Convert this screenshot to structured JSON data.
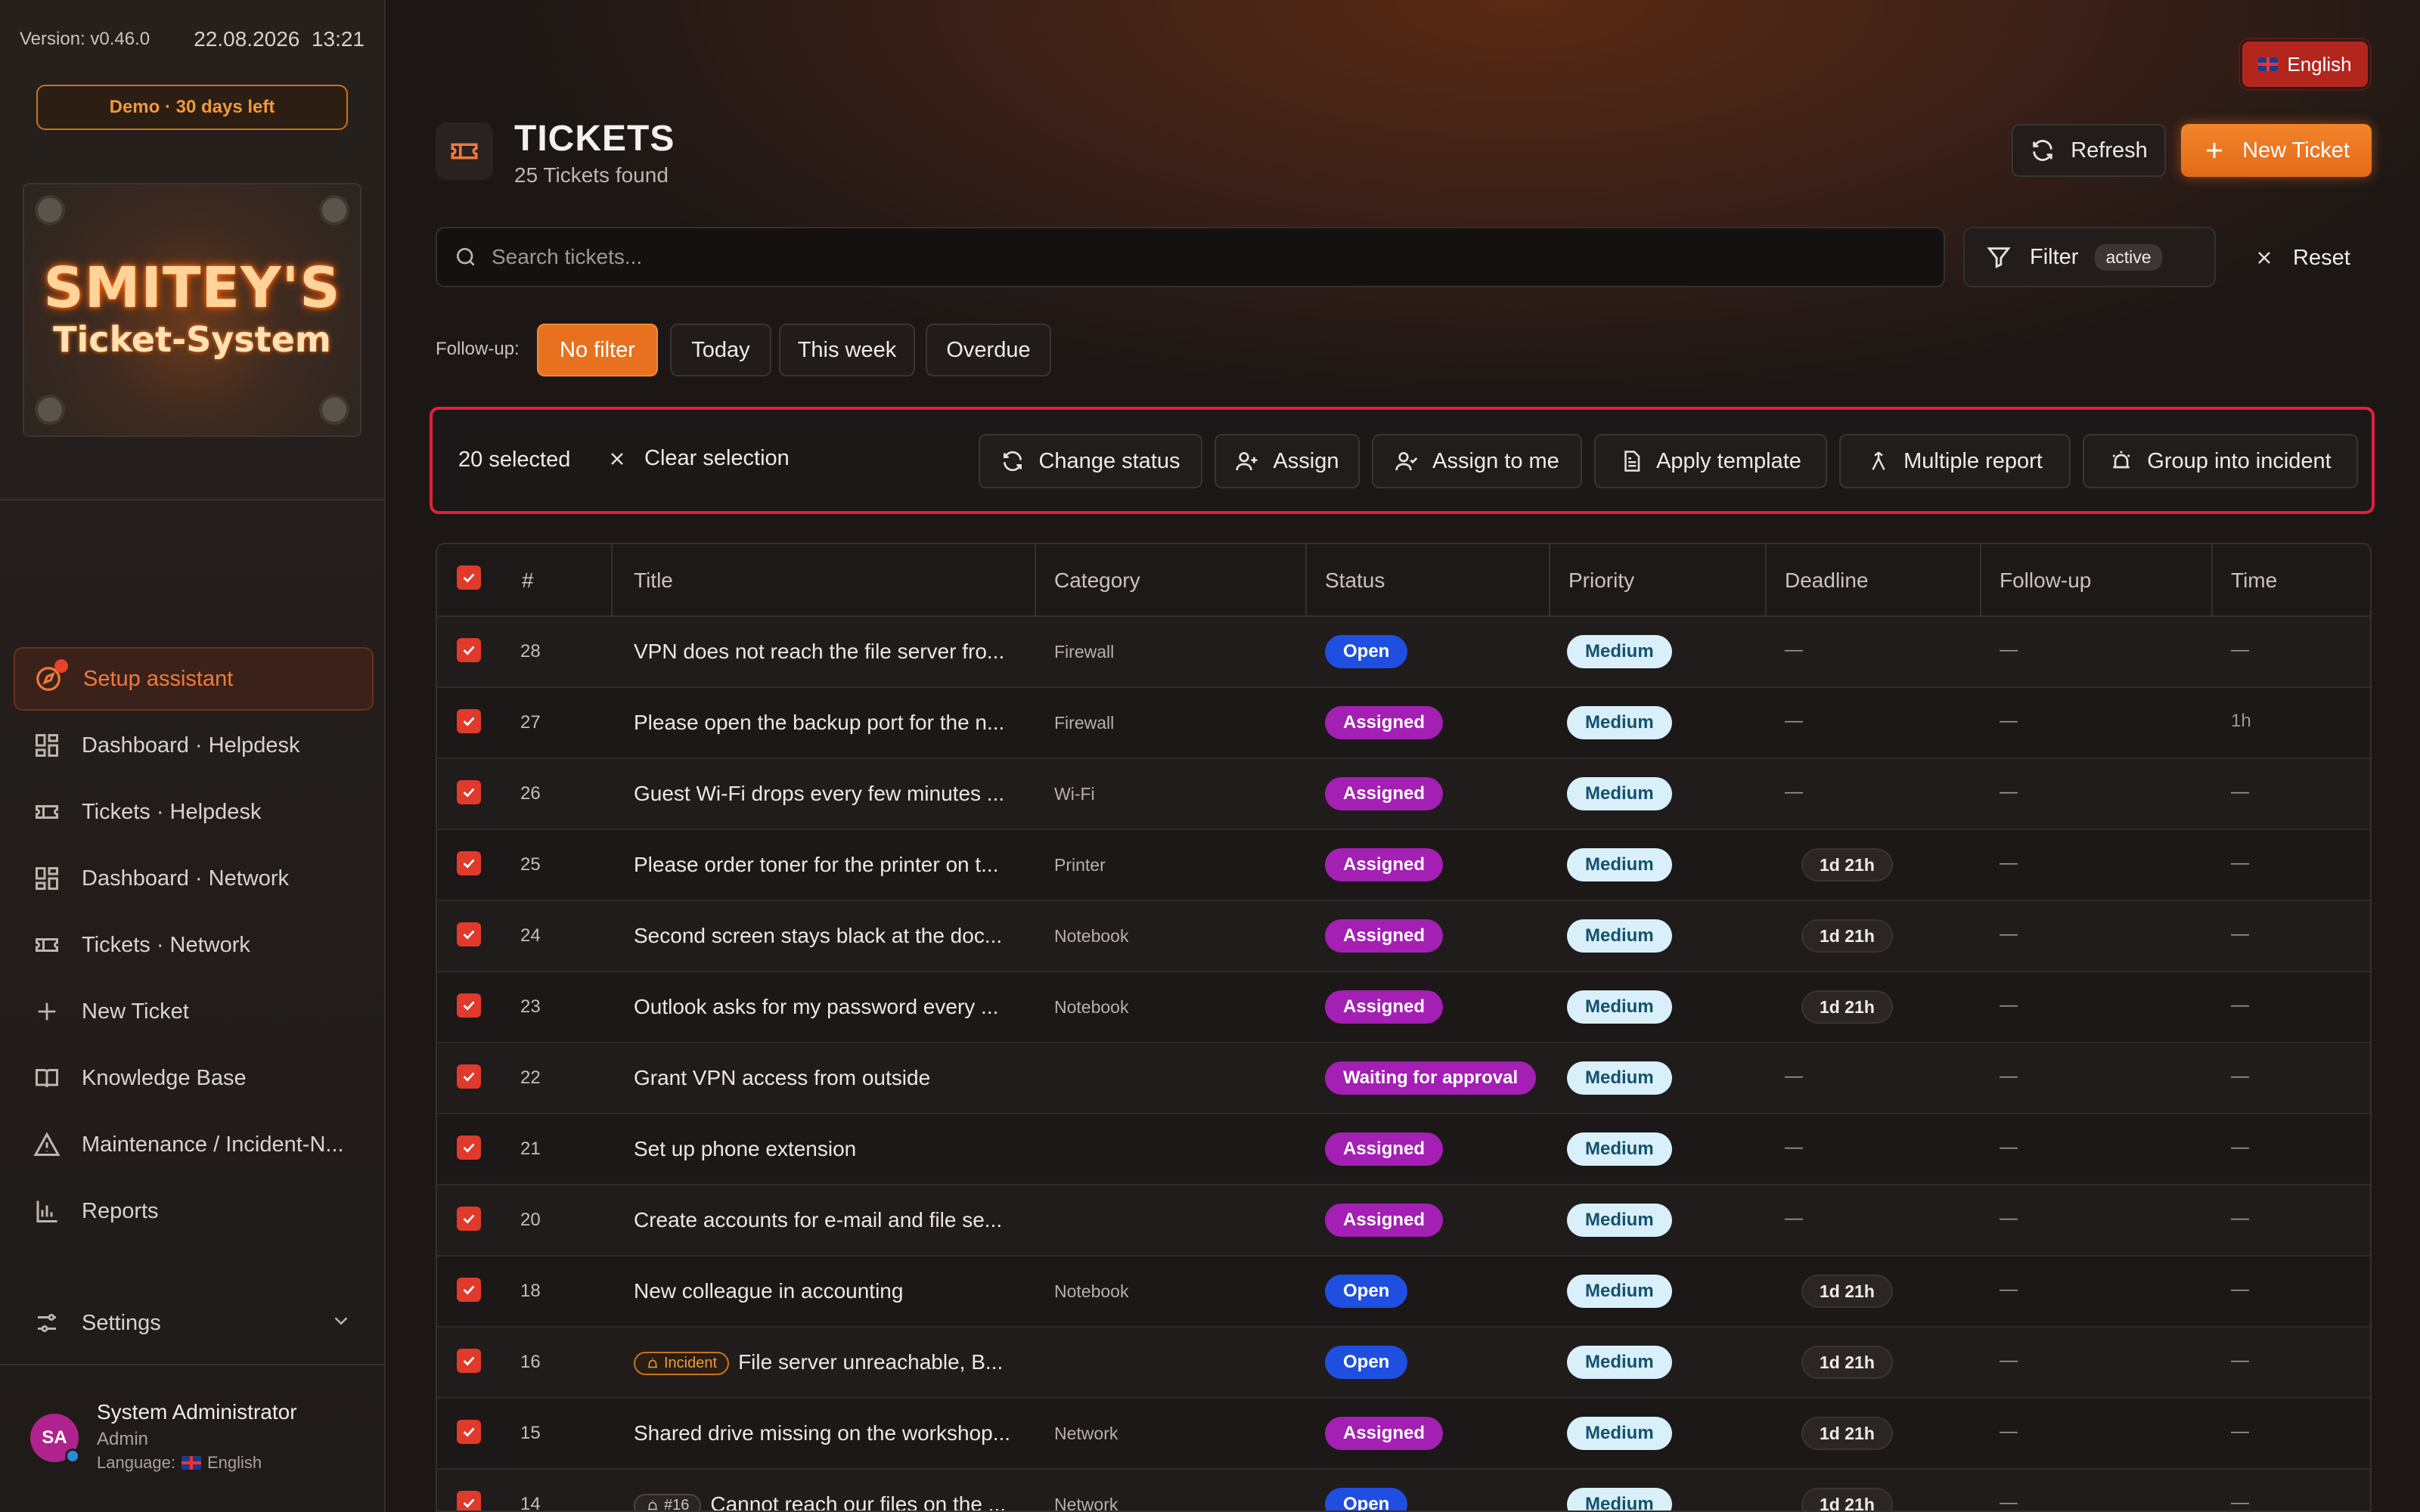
{
  "sidebar": {
    "version": "Version: v0.46.0",
    "date": "22.08.2026",
    "time": "13:21",
    "demo": "Demo · 30 days left",
    "logo_line1": "SMITEY'S",
    "logo_line2": "Ticket-System",
    "items": [
      {
        "label": "Setup assistant",
        "icon": "setup-icon"
      },
      {
        "label": "Dashboard · Helpdesk",
        "icon": "dashboard-icon"
      },
      {
        "label": "Tickets · Helpdesk",
        "icon": "ticket-icon"
      },
      {
        "label": "Dashboard · Network",
        "icon": "dashboard-icon"
      },
      {
        "label": "Tickets · Network",
        "icon": "ticket-icon"
      },
      {
        "label": "New Ticket",
        "icon": "plus-icon"
      },
      {
        "label": "Knowledge Base",
        "icon": "book-icon"
      },
      {
        "label": "Maintenance / Incident-N...",
        "icon": "warning-icon"
      },
      {
        "label": "Reports",
        "icon": "chart-icon"
      },
      {
        "label": "Settings",
        "icon": "sliders-icon"
      }
    ],
    "user": {
      "initials": "SA",
      "name": "System Administrator",
      "role": "Admin",
      "language_label": "Language:",
      "language": "English"
    }
  },
  "header": {
    "language": "English",
    "title": "TICKETS",
    "subtitle": "25 Tickets found",
    "refresh": "Refresh",
    "new_ticket": "New Ticket"
  },
  "search": {
    "placeholder": "Search tickets..."
  },
  "filter": {
    "label": "Filter",
    "badge": "active",
    "reset": "Reset"
  },
  "followup": {
    "label": "Follow-up:",
    "options": [
      "No filter",
      "Today",
      "This week",
      "Overdue"
    ],
    "selected": "No filter"
  },
  "bulk": {
    "selected": "20 selected",
    "clear": "Clear selection",
    "actions": [
      "Change status",
      "Assign",
      "Assign to me",
      "Apply template",
      "Multiple report",
      "Group into incident"
    ]
  },
  "table": {
    "columns": [
      "#",
      "Title",
      "Category",
      "Status",
      "Priority",
      "Deadline",
      "Follow-up",
      "Time"
    ],
    "rows": [
      {
        "id": "28",
        "title": "VPN does not reach the file server fro...",
        "category": "Firewall",
        "status": "Open",
        "priority": "Medium",
        "deadline": "—",
        "followup": "—",
        "time": "—"
      },
      {
        "id": "27",
        "title": "Please open the backup port for the n...",
        "category": "Firewall",
        "status": "Assigned",
        "priority": "Medium",
        "deadline": "—",
        "followup": "—",
        "time": "1h"
      },
      {
        "id": "26",
        "title": "Guest Wi-Fi drops every few minutes ...",
        "category": "Wi-Fi",
        "status": "Assigned",
        "priority": "Medium",
        "deadline": "—",
        "followup": "—",
        "time": "—"
      },
      {
        "id": "25",
        "title": "Please order toner for the printer on t...",
        "category": "Printer",
        "status": "Assigned",
        "priority": "Medium",
        "deadline": "1d 21h",
        "followup": "—",
        "time": "—"
      },
      {
        "id": "24",
        "title": "Second screen stays black at the doc...",
        "category": "Notebook",
        "status": "Assigned",
        "priority": "Medium",
        "deadline": "1d 21h",
        "followup": "—",
        "time": "—"
      },
      {
        "id": "23",
        "title": "Outlook asks for my password every ...",
        "category": "Notebook",
        "status": "Assigned",
        "priority": "Medium",
        "deadline": "1d 21h",
        "followup": "—",
        "time": "—"
      },
      {
        "id": "22",
        "title": "Grant VPN access from outside",
        "category": "",
        "status": "Waiting for approval",
        "priority": "Medium",
        "deadline": "—",
        "followup": "—",
        "time": "—"
      },
      {
        "id": "21",
        "title": "Set up phone extension",
        "category": "",
        "status": "Assigned",
        "priority": "Medium",
        "deadline": "—",
        "followup": "—",
        "time": "—"
      },
      {
        "id": "20",
        "title": "Create accounts for e-mail and file se...",
        "category": "",
        "status": "Assigned",
        "priority": "Medium",
        "deadline": "—",
        "followup": "—",
        "time": "—"
      },
      {
        "id": "18",
        "title": "New colleague in accounting",
        "category": "Notebook",
        "status": "Open",
        "priority": "Medium",
        "deadline": "1d 21h",
        "followup": "—",
        "time": "—"
      },
      {
        "id": "16",
        "tag": "Incident",
        "title": "File server unreachable, B...",
        "category": "",
        "status": "Open",
        "priority": "Medium",
        "deadline": "1d 21h",
        "followup": "—",
        "time": "—"
      },
      {
        "id": "15",
        "title": "Shared drive missing on the workshop...",
        "category": "Network",
        "status": "Assigned",
        "priority": "Medium",
        "deadline": "1d 21h",
        "followup": "—",
        "time": "—"
      },
      {
        "id": "14",
        "tag": "#16",
        "title": "Cannot reach our files on the ...",
        "category": "Network",
        "status": "Open",
        "priority": "Medium",
        "deadline": "1d 21h",
        "followup": "—",
        "time": "—"
      }
    ]
  },
  "colors": {
    "accent": "#e8711f",
    "danger": "#e0203c",
    "open": "#1f4fe0",
    "assigned": "#a41fb3",
    "medium_bg": "#d9f0fb"
  }
}
